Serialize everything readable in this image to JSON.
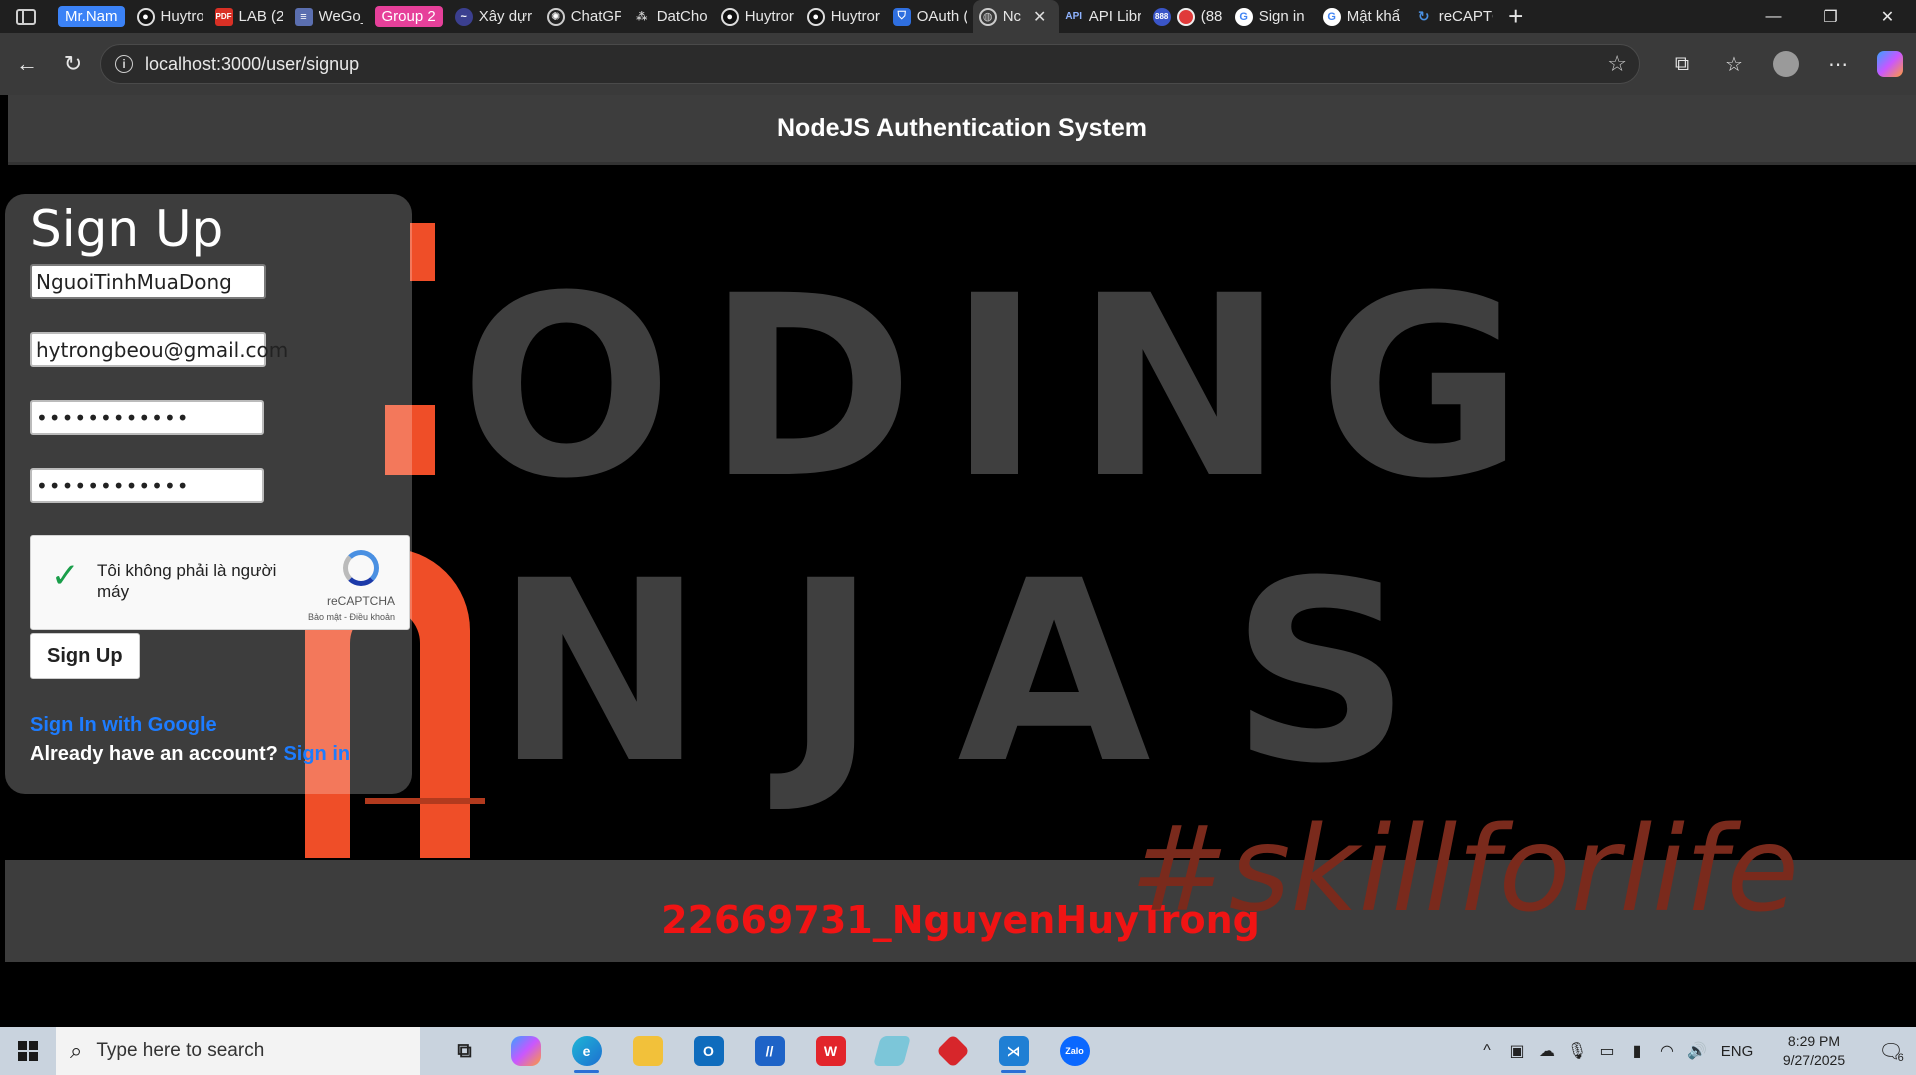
{
  "browser": {
    "tabs": [
      {
        "label": "Mr.Nam",
        "kind": "group",
        "color": "#3b82f6"
      },
      {
        "label": "Huytror",
        "icon": "github-icon"
      },
      {
        "label": "LAB (2).",
        "icon": "pdf-icon"
      },
      {
        "label": "WeGo_u",
        "icon": "doc-icon"
      },
      {
        "label": "Group 2",
        "kind": "group",
        "color": "#e6409a"
      },
      {
        "label": "Xây dựr",
        "icon": "app-icon"
      },
      {
        "label": "ChatGP",
        "icon": "chatgpt-icon"
      },
      {
        "label": "DatCho",
        "icon": "app-icon"
      },
      {
        "label": "Huytror",
        "icon": "github-icon"
      },
      {
        "label": "Huytror",
        "icon": "github-icon"
      },
      {
        "label": "OAuth (",
        "icon": "shield-icon"
      },
      {
        "label": "Nc",
        "icon": "globe-icon",
        "active": true
      },
      {
        "label": "API Libr",
        "icon": "api-icon"
      },
      {
        "label": "(88",
        "icon": "record-icon"
      },
      {
        "label": "Sign in",
        "icon": "google-icon"
      },
      {
        "label": "Mật khẩ",
        "icon": "google-icon"
      },
      {
        "label": "reCAPTC",
        "icon": "recaptcha-icon"
      }
    ],
    "url": "localhost:3000/user/signup"
  },
  "app": {
    "header_title": "NodeJS Authentication System",
    "form": {
      "title": "Sign Up",
      "username_value": "NguoiTinhMuaDong",
      "email_value": "hytrongbeou@gmail.com",
      "password_mask": "••••••••••••",
      "confirm_mask": "••••••••••••",
      "captcha_text": "Tôi không phải là người máy",
      "captcha_brand": "reCAPTCHA",
      "captcha_terms": "Bảo mật - Điều khoản",
      "submit_label": "Sign Up",
      "google_link": "Sign In with Google",
      "already_text": "Already have an account?",
      "signin_link": "Sign in"
    },
    "background": {
      "line1": "ODING",
      "line2": "NJAS",
      "tagline": "#skillforlife"
    },
    "footer_id": "22669731_NguyenHuyTrong"
  },
  "taskbar": {
    "search_placeholder": "Type here to search",
    "language": "ENG",
    "time": "8:29 PM",
    "date": "9/27/2025",
    "notification_count": "6"
  },
  "colors": {
    "accent_link": "#1d7cff",
    "brand_red": "#ef4e28",
    "footer_text": "#f01414"
  }
}
